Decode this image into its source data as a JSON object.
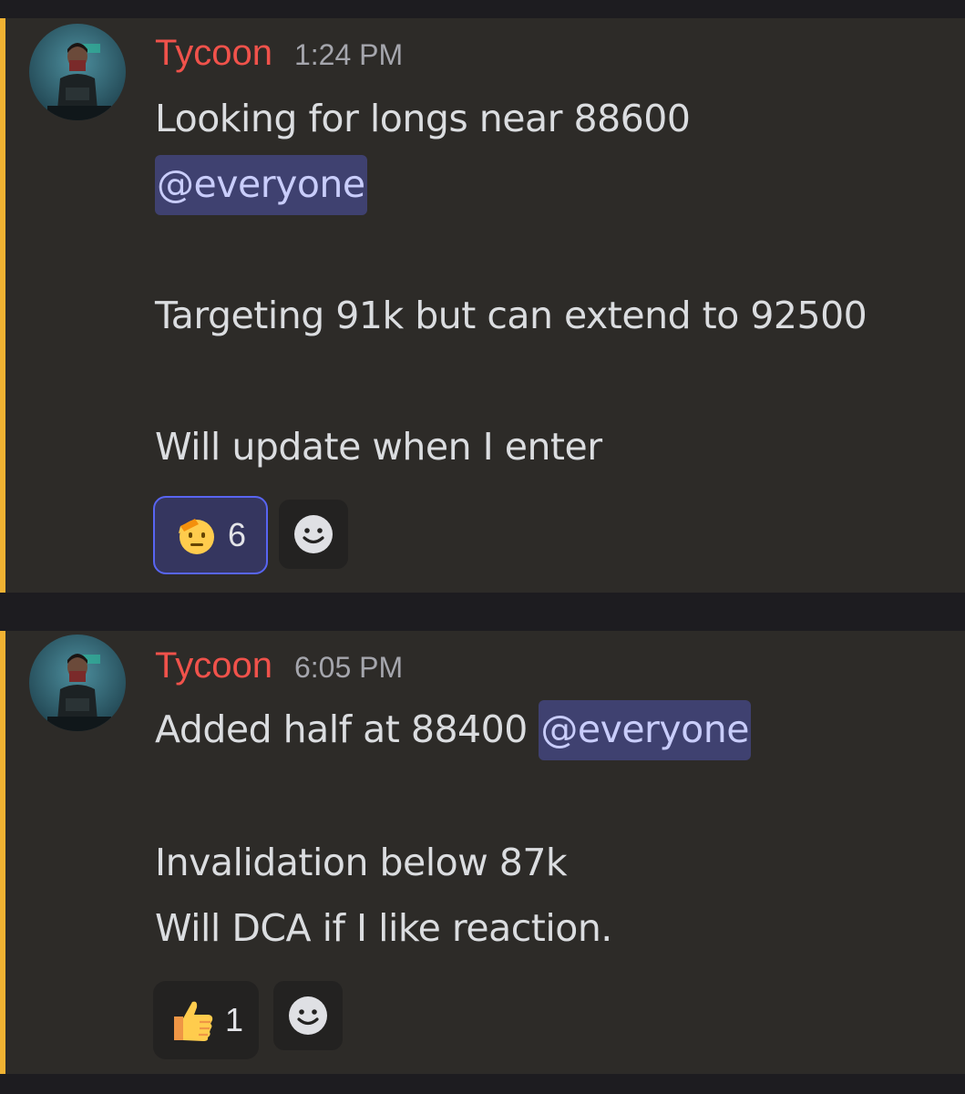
{
  "messages": [
    {
      "username": "Tycoon",
      "timestamp": "1:24 PM",
      "line1": "Looking for longs near 88600",
      "mention1": "@everyone",
      "line2": "Targeting 91k but can extend to 92500",
      "line3": "Will update when I enter",
      "reaction": {
        "emoji": "saluting-face",
        "count": "6",
        "reacted_by_me": true
      }
    },
    {
      "username": "Tycoon",
      "timestamp": "6:05 PM",
      "line1": "Added half at 88400",
      "mention1": "@everyone",
      "line2": "Invalidation below 87k",
      "line3": "Will DCA if I like reaction.",
      "reaction": {
        "emoji": "thumbs-up",
        "count": "1",
        "reacted_by_me": false
      }
    }
  ],
  "colors": {
    "username": "#f0524b",
    "mention_bg": "#3f4170",
    "mention_text": "#c9cdfb",
    "highlight_bar": "#f0b232",
    "message_bg": "#2d2b28",
    "page_bg": "#1d1c20"
  },
  "icons": {
    "add_reaction": "smiley-icon"
  }
}
